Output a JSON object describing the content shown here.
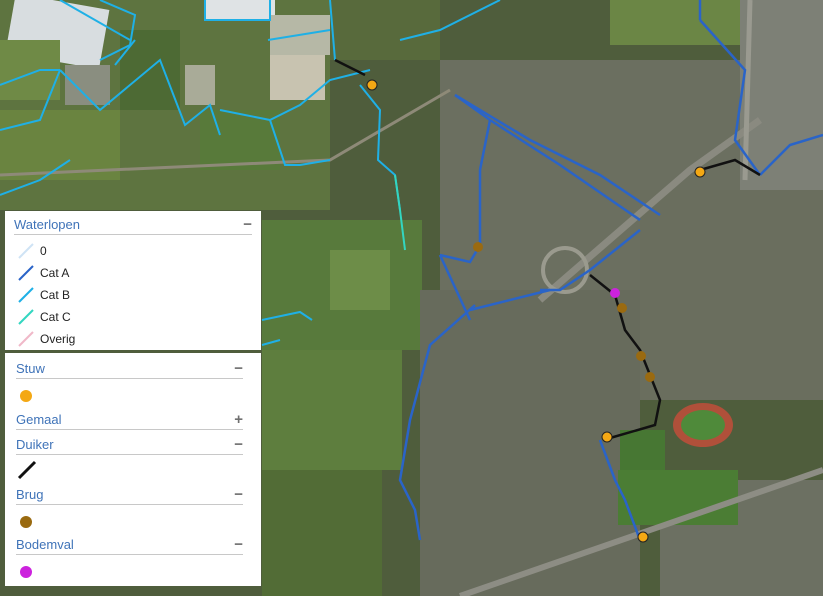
{
  "colors": {
    "cat0": "#cfe3f5",
    "catA": "#2a64c8",
    "catB": "#1fb0e6",
    "catC": "#33d6c0",
    "overig": "#f0b8c8",
    "stuw": "#f4a814",
    "duiker": "#111111",
    "brug": "#9a6a10",
    "bodemval": "#cc22dd"
  },
  "legend": {
    "waterlopen": {
      "title": "Waterlopen",
      "toggle": "−",
      "items": [
        {
          "label": "0",
          "color": "#cfe3f5"
        },
        {
          "label": "Cat A",
          "color": "#2a64c8"
        },
        {
          "label": "Cat B",
          "color": "#1fb0e6"
        },
        {
          "label": "Cat C",
          "color": "#33d6c0"
        },
        {
          "label": "Overig",
          "color": "#f0b8c8"
        }
      ]
    },
    "stuw": {
      "title": "Stuw",
      "toggle": "−"
    },
    "gemaal": {
      "title": "Gemaal",
      "toggle": "+"
    },
    "duiker": {
      "title": "Duiker",
      "toggle": "−"
    },
    "brug": {
      "title": "Brug",
      "toggle": "−"
    },
    "bodemval": {
      "title": "Bodemval",
      "toggle": "−"
    }
  }
}
